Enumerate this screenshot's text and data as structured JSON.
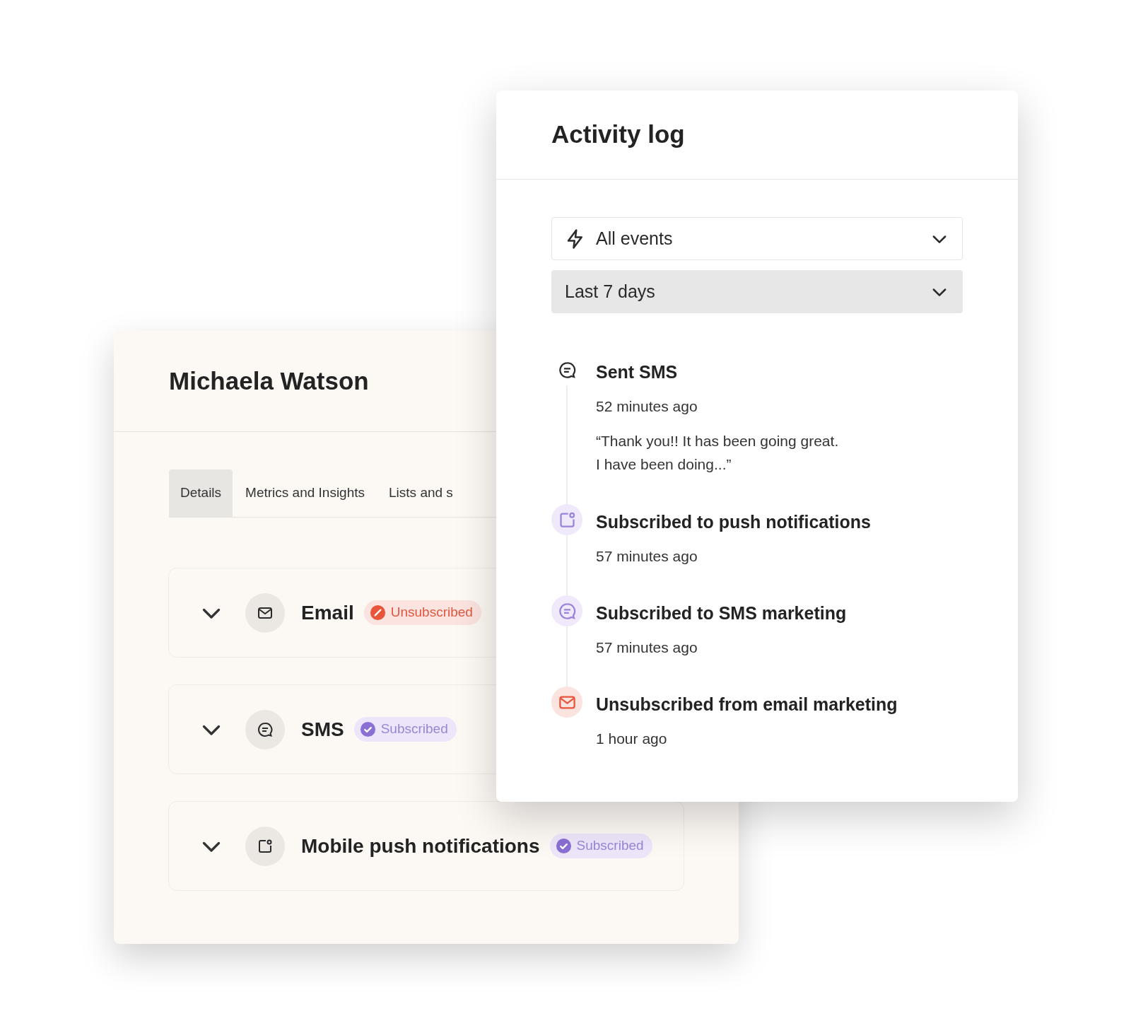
{
  "profile": {
    "name": "Michaela Watson",
    "tabs": [
      {
        "label": "Details",
        "selected": true
      },
      {
        "label": "Metrics and Insights",
        "selected": false
      },
      {
        "label": "Lists and s",
        "selected": false
      }
    ],
    "channels": [
      {
        "kind": "email",
        "label": "Email",
        "expanded": false,
        "subscribed": false,
        "badge": "Unsubscribed"
      },
      {
        "kind": "sms",
        "label": "SMS",
        "expanded": false,
        "subscribed": true,
        "badge": "Subscribed"
      },
      {
        "kind": "push",
        "label": "Mobile push notifications",
        "expanded": false,
        "subscribed": true,
        "badge": "Subscribed"
      }
    ]
  },
  "activity_log": {
    "title": "Activity log",
    "filters": [
      {
        "kind": "events",
        "value": "All events",
        "highlighted": false
      },
      {
        "kind": "period",
        "value": "Last 7 days",
        "highlighted": true
      }
    ],
    "events": [
      {
        "kind": "message",
        "title": "Sent SMS",
        "time": "52 minutes ago",
        "message": "“Thank you!! It has been going great.\nI have been doing...”"
      },
      {
        "kind": "push-subscribe",
        "title": "Subscribed to push notifications",
        "time": "57 minutes ago"
      },
      {
        "kind": "sms-subscribe",
        "title": "Subscribed to SMS marketing",
        "time": "57 minutes ago"
      },
      {
        "kind": "email-unsubscribe",
        "title": "Unsubscribed from email marketing",
        "time": "1 hour ago"
      }
    ]
  }
}
